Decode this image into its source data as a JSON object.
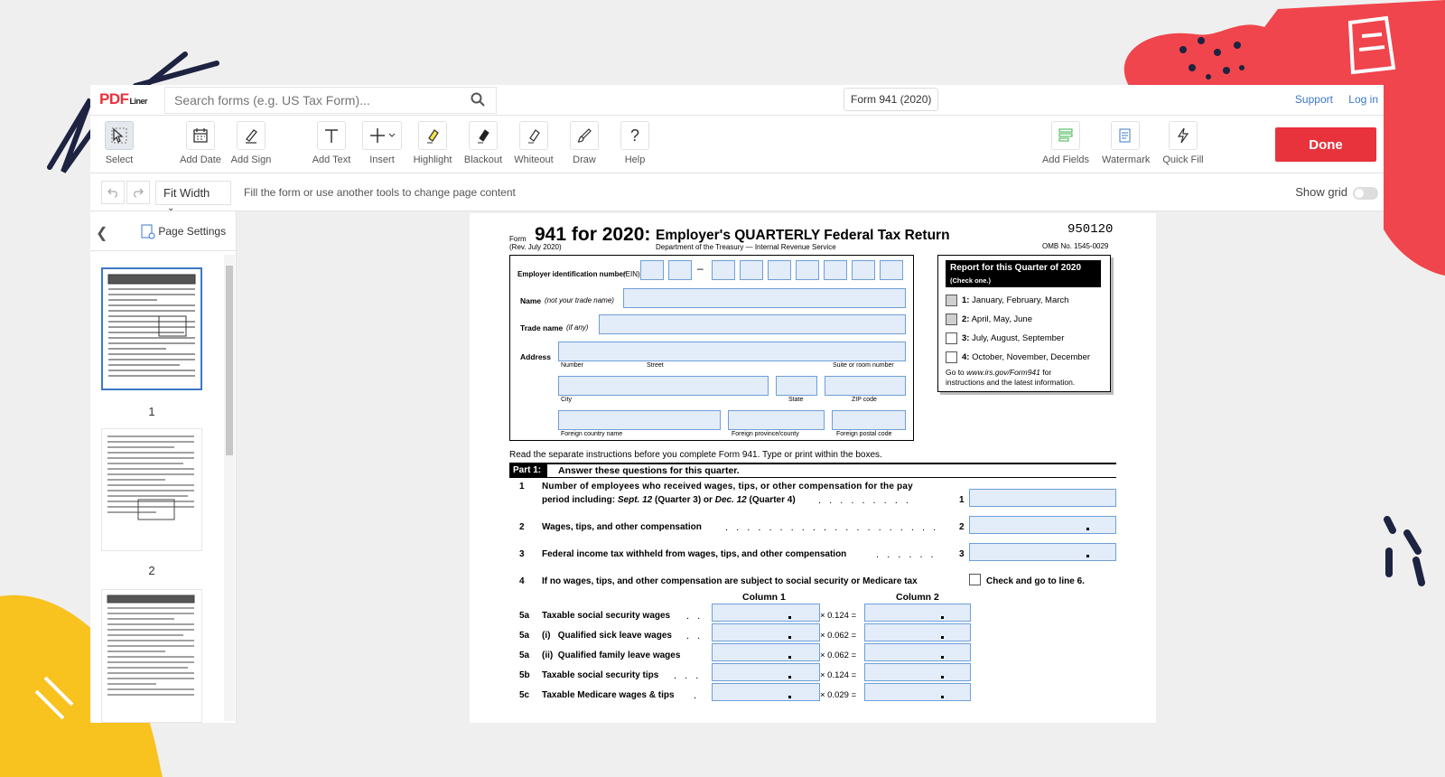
{
  "app": {
    "logo_main": "PDF",
    "logo_sub": "Liner",
    "search_placeholder": "Search forms (e.g. US Tax Form)...",
    "form_name": "Form 941 (2020)",
    "links": [
      "Support",
      "Log in"
    ]
  },
  "toolbar": {
    "tools": [
      {
        "label": "Select",
        "icon": "cursor-icon",
        "active": true
      },
      {
        "label": "Add Date",
        "icon": "calendar-icon"
      },
      {
        "label": "Add Sign",
        "icon": "pen-icon"
      },
      {
        "label": "Add Text",
        "icon": "text-icon"
      },
      {
        "label": "Insert",
        "icon": "plus-icon"
      },
      {
        "label": "Highlight",
        "icon": "highlighter-icon"
      },
      {
        "label": "Blackout",
        "icon": "blackout-icon"
      },
      {
        "label": "Whiteout",
        "icon": "eraser-icon"
      },
      {
        "label": "Draw",
        "icon": "brush-icon"
      },
      {
        "label": "Help",
        "icon": "question-icon"
      }
    ],
    "right_tools": [
      {
        "label": "Add Fields",
        "icon": "fields-icon"
      },
      {
        "label": "Watermark",
        "icon": "watermark-icon"
      },
      {
        "label": "Quick Fill",
        "icon": "lightning-icon"
      }
    ],
    "done_label": "Done"
  },
  "subbar": {
    "zoom": "Fit Width",
    "hint": "Fill the form or use another tools to change page content",
    "show_grid_label": "Show grid"
  },
  "sidebar": {
    "page_settings_label": "Page Settings",
    "pages": [
      "1",
      "2"
    ]
  },
  "form": {
    "form_word": "Form",
    "number": "941 for 2020:",
    "title": "Employer's QUARTERLY Federal Tax Return",
    "rev": "(Rev. July 2020)",
    "dept": "Department of the Treasury — Internal Revenue Service",
    "code": "950120",
    "omb": "OMB No. 1545-0029",
    "ein_label": "Employer identification number",
    "ein_suffix": "(EIN)",
    "name_label": "Name",
    "name_hint": "(not your trade name)",
    "trade_label": "Trade name",
    "trade_hint": "(if any)",
    "address_label": "Address",
    "addr_sub": [
      "Number",
      "Street",
      "Suite or room number"
    ],
    "city_sub": [
      "City",
      "State",
      "ZIP code"
    ],
    "foreign_sub": [
      "Foreign country name",
      "Foreign province/county",
      "Foreign postal code"
    ],
    "quarter_title": "Report for this Quarter of 2020",
    "quarter_hint": "(Check one.)",
    "quarters": [
      {
        "num": "1:",
        "label": "January, February, March",
        "state": "grey"
      },
      {
        "num": "2:",
        "label": "April, May, June",
        "state": "grey"
      },
      {
        "num": "3:",
        "label": "July, August, September",
        "state": "empty"
      },
      {
        "num": "4:",
        "label": "October, November, December",
        "state": "empty"
      }
    ],
    "go_to_pre": "Go to",
    "go_to_url": "www.irs.gov/Form941",
    "go_to_post": "for",
    "go_to_line2": "instructions and the latest information.",
    "read_line": "Read the separate instructions before you complete Form 941. Type or print within the boxes.",
    "part1": "Part 1:",
    "part1_title": "Answer these questions for this quarter.",
    "line1_num": "1",
    "line1_a": "Number of employees who received wages, tips, or other compensation for the pay",
    "line1_b_pre": "period including:",
    "line1_b_it1": "Sept. 12",
    "line1_b_mid": "(Quarter 3) or",
    "line1_b_it2": "Dec. 12",
    "line1_b_post": "(Quarter 4)",
    "line2_num": "2",
    "line2": "Wages, tips, and other compensation",
    "line3_num": "3",
    "line3": "Federal income tax withheld from wages, tips, and other compensation",
    "line4_num": "4",
    "line4": "If no wages, tips, and other compensation are subject to social security or Medicare tax",
    "line4_check": "Check and go to line 6.",
    "col1": "Column 1",
    "col2": "Column 2",
    "rows5": [
      {
        "num": "5a",
        "label": "Taxable social security wages",
        "rate": "× 0.124 ="
      },
      {
        "num": "5a",
        "label": "(i)   Qualified sick leave wages",
        "rate": "× 0.062 ="
      },
      {
        "num": "5a",
        "label": "(ii)  Qualified family leave wages",
        "rate": "× 0.062 ="
      },
      {
        "num": "5b",
        "label": "Taxable social security tips",
        "rate": "× 0.124 ="
      },
      {
        "num": "5c",
        "label": "Taxable Medicare wages & tips",
        "rate": "× 0.029 ="
      }
    ]
  }
}
